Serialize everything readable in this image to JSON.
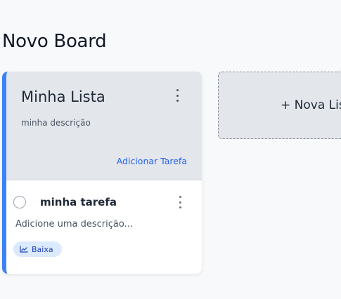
{
  "board": {
    "title": "Novo Board"
  },
  "list": {
    "title": "Minha Lista",
    "description": "minha descrição",
    "add_task_label": "Adicionar Tarefa",
    "accent_color": "#3b82f6",
    "menu_icon": "more-vertical-icon"
  },
  "task": {
    "title": "minha tarefa",
    "description_placeholder": "Adicione uma descrição...",
    "completed": false,
    "menu_icon": "more-vertical-icon",
    "priority": {
      "label": "Baixa",
      "icon": "chart-line-icon",
      "color": "#1e40af",
      "background": "#dbeafe"
    }
  },
  "new_list": {
    "label": "+ Nova Lista"
  }
}
